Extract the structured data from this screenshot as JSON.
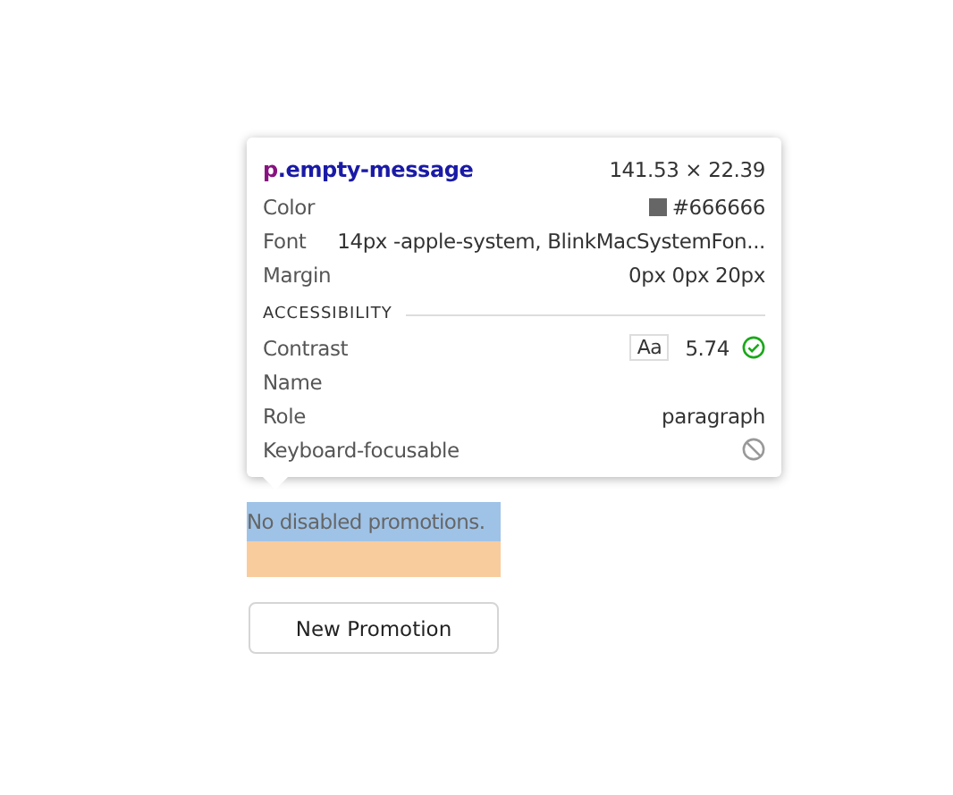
{
  "inspector": {
    "tag": "p",
    "class_name": ".empty-message",
    "size": "141.53 × 22.39",
    "properties": [
      {
        "kind": "color",
        "label": "Color",
        "value": "#666666",
        "color": "#666666"
      },
      {
        "kind": "text",
        "label": "Font",
        "value": "14px -apple-system, BlinkMacSystemFon..."
      },
      {
        "kind": "text",
        "label": "Margin",
        "value": "0px 0px 20px"
      }
    ],
    "section": "ACCESSIBILITY",
    "accessibility": [
      {
        "kind": "contrast",
        "label": "Contrast",
        "sample": "Aa",
        "value": "5.74",
        "passes": true
      },
      {
        "kind": "text",
        "label": "Name"
      },
      {
        "kind": "text",
        "label": "Role",
        "value": "paragraph"
      },
      {
        "kind": "focusable",
        "label": "Keyboard-focusable",
        "focusable": false
      }
    ]
  },
  "empty_message": "No disabled promotions.",
  "button": "New Promotion"
}
